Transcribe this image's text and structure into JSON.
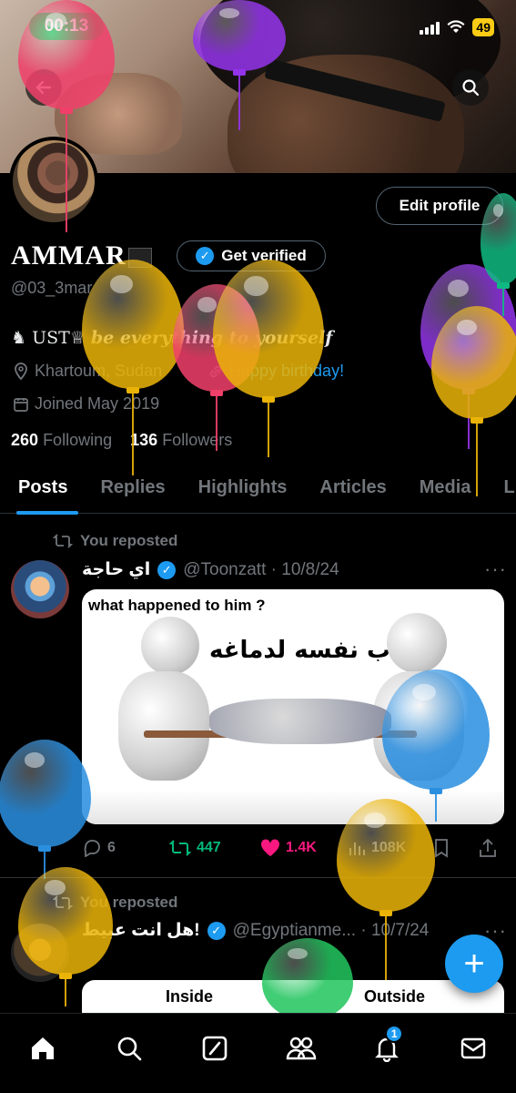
{
  "status_bar": {
    "time": "00:13",
    "battery": "49"
  },
  "profile": {
    "name": "AMMAR",
    "get_verified_label": "Get verified",
    "handle": "@03_3mar",
    "edit_profile_label": "Edit profile",
    "bio_prefix": "UST",
    "bio_italic": "be everything to yourself",
    "location": "Khartoum, Sudan",
    "website": "Happy birthday!",
    "joined": "Joined May 2019",
    "following_count": "260",
    "following_label": "Following",
    "followers_count": "136",
    "followers_label": "Followers"
  },
  "tabs": [
    {
      "label": "Posts",
      "active": true
    },
    {
      "label": "Replies"
    },
    {
      "label": "Highlights"
    },
    {
      "label": "Articles"
    },
    {
      "label": "Media"
    },
    {
      "label": "L"
    }
  ],
  "posts": [
    {
      "repost_label": "You reposted",
      "author_name": "اي حاجة",
      "handle_date": "@Toonzatt · 10/8/24",
      "media_caption": "what happened to him ?",
      "media_arabic": "ساب نفسه لدماغه",
      "replies": "6",
      "reposts": "447",
      "likes": "1.4K",
      "views": "108K"
    },
    {
      "repost_label": "You reposted",
      "author_name": "هل انت عبيط!",
      "handle_date": "@Egyptianme... · 10/7/24",
      "media_left": "Inside",
      "media_right": "Outside"
    }
  ],
  "nav": {
    "notification_count": "1"
  },
  "colors": {
    "accent": "#1d9bf0",
    "repost_green": "#00ba7c",
    "like_pink": "#f91880",
    "status_green": "#22c55e",
    "battery_yellow": "#facc15"
  },
  "icons": [
    "back-arrow-icon",
    "search-icon",
    "verified-badge-icon",
    "location-icon",
    "link-icon",
    "calendar-icon",
    "repost-icon",
    "reply-icon",
    "like-icon",
    "views-icon",
    "bookmark-icon",
    "share-icon",
    "more-icon",
    "home-icon",
    "grok-icon",
    "communities-icon",
    "bell-icon",
    "mail-icon",
    "compose-plus-icon"
  ]
}
